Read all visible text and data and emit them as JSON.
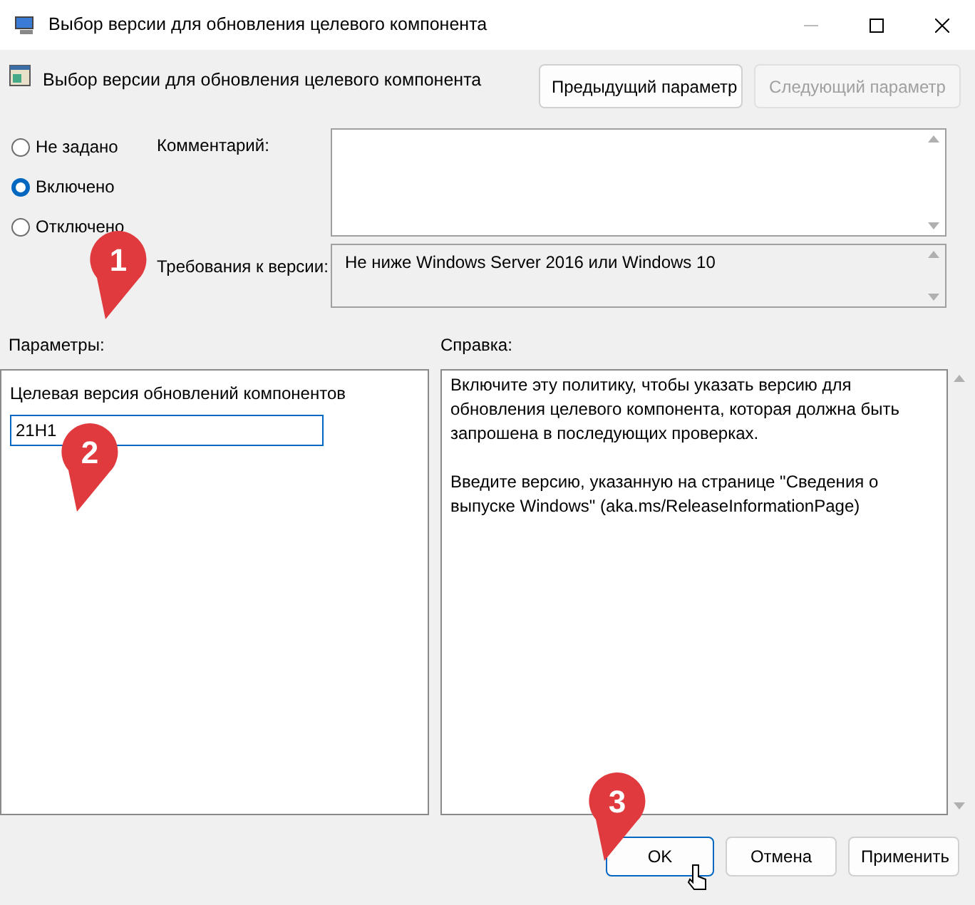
{
  "window": {
    "title": "Выбор версии для обновления целевого компонента"
  },
  "header": {
    "title": "Выбор версии для обновления целевого компонента",
    "buttons": [
      {
        "label": "Предыдущий параметр",
        "disabled": false
      },
      {
        "label": "Следующий параметр",
        "disabled": true
      }
    ]
  },
  "state_options": [
    {
      "label": "Не задано",
      "selected": false
    },
    {
      "label": "Включено",
      "selected": true
    },
    {
      "label": "Отключено",
      "selected": false
    }
  ],
  "comment": {
    "label": "Комментарий:"
  },
  "requirements": {
    "label": "Требования к версии:",
    "value": "Не ниже Windows Server 2016 или Windows 10"
  },
  "parameters": {
    "label": "Параметры:",
    "field_label": "Целевая версия обновлений компонентов",
    "value": "21H1"
  },
  "help": {
    "label": "Справка:",
    "paragraphs": [
      "Включите эту политику, чтобы указать версию для обновления целевого компонента, которая должна быть запрошена в последующих проверках.",
      "Введите версию, указанную на странице \"Сведения о выпуске Windows\" (aka.ms/ReleaseInformationPage)"
    ]
  },
  "buttons": [
    {
      "label": "OK",
      "default": true
    },
    {
      "label": "Отмена",
      "default": false
    },
    {
      "label": "Применить",
      "default": false
    }
  ],
  "annotations": [
    {
      "label": "1"
    },
    {
      "label": "2"
    },
    {
      "label": "3"
    }
  ]
}
